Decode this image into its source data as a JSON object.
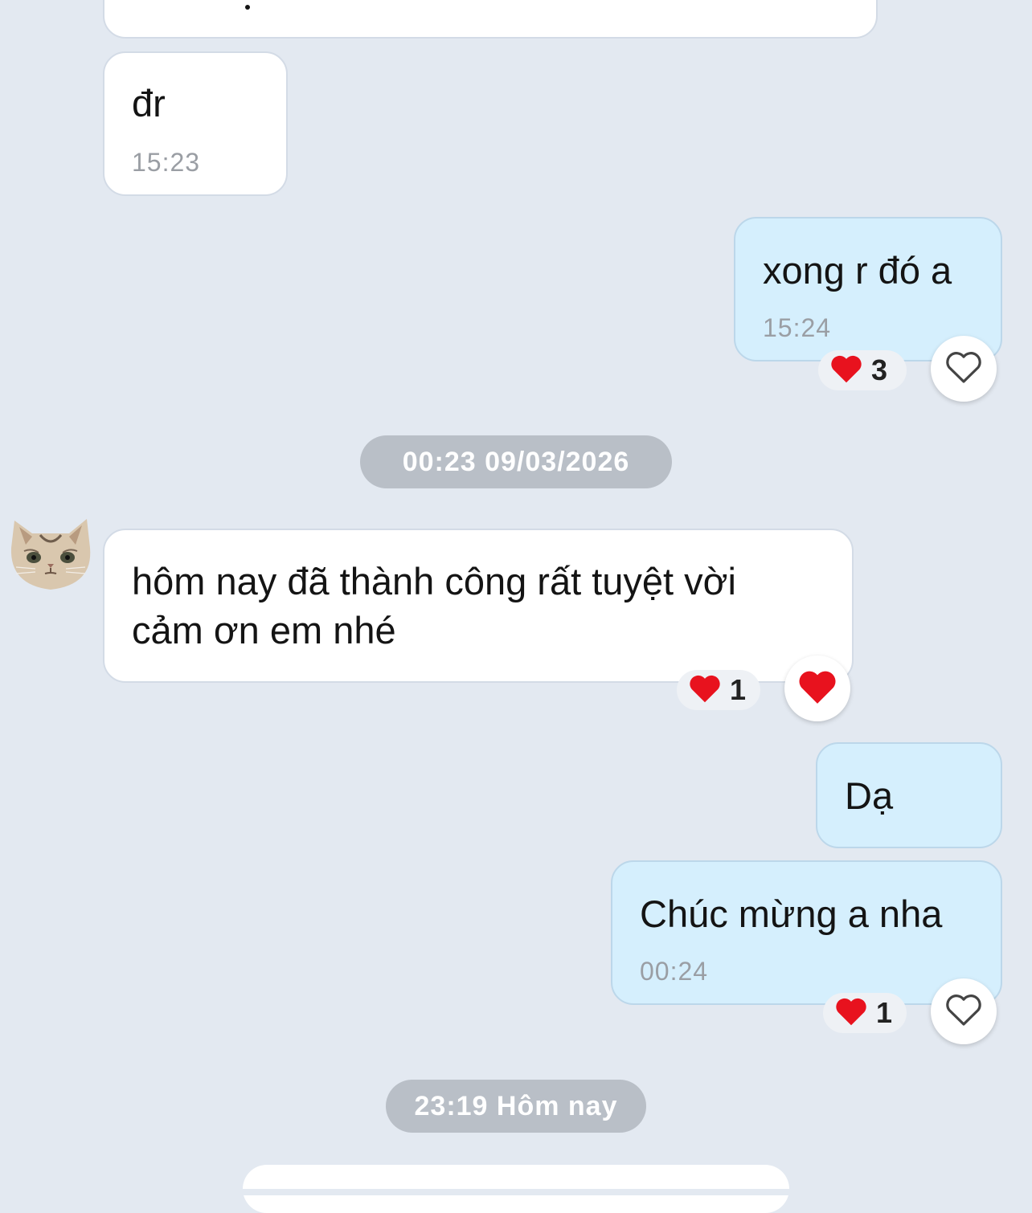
{
  "messages": [
    {
      "text": "đr",
      "time": "15:23"
    },
    {
      "text": "xong r đó a",
      "time": "15:24",
      "reaction_count": "3"
    },
    {
      "text_line1": "hôm nay đã thành công rất tuyệt vời",
      "text_line2": "cảm ơn em nhé",
      "reaction_count": "1"
    },
    {
      "text": "Dạ"
    },
    {
      "text": "Chúc mừng a nha",
      "time": "00:24",
      "reaction_count": "1"
    }
  ],
  "date_separators": [
    "00:23 09/03/2026",
    "23:19 Hôm nay"
  ],
  "reaction_emoji": "heart-icon",
  "colors": {
    "background": "#e3e9f1",
    "incoming": "#ffffff",
    "outgoing": "#d5effd",
    "heart": "#e8121e"
  }
}
